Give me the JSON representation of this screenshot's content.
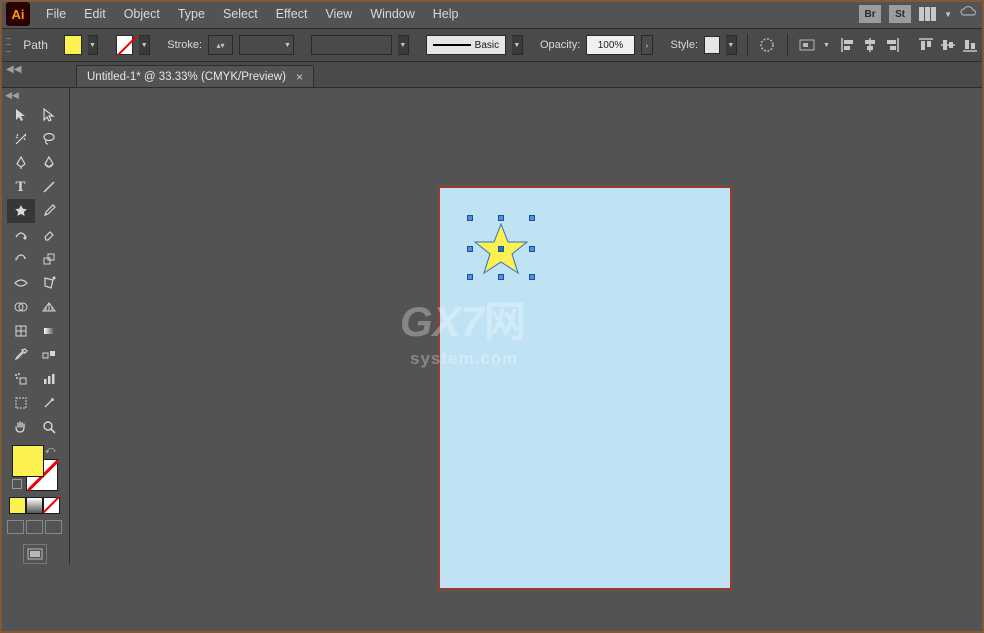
{
  "app": {
    "logo": "Ai"
  },
  "menu": {
    "file": "File",
    "edit": "Edit",
    "object": "Object",
    "type": "Type",
    "select": "Select",
    "effect": "Effect",
    "view": "View",
    "window": "Window",
    "help": "Help"
  },
  "menuRight": {
    "br": "Br",
    "st": "St"
  },
  "control": {
    "mode": "Path",
    "fill_color": "#fcf151",
    "stroke_label": "Stroke:",
    "brush_label": "Basic",
    "opacity_label": "Opacity:",
    "opacity_value": "100%",
    "style_label": "Style:"
  },
  "tab": {
    "title": "Untitled-1* @ 33.33% (CMYK/Preview)",
    "close": "×"
  },
  "tools": {
    "row_icons": [
      [
        "selection",
        "direct-selection"
      ],
      [
        "magic-wand",
        "lasso"
      ],
      [
        "pen",
        "curvature-pen"
      ],
      [
        "type",
        "line-segment"
      ],
      [
        "star",
        "paintbrush"
      ],
      [
        "shaper",
        "eraser"
      ],
      [
        "rotate",
        "scale"
      ],
      [
        "width",
        "free-transform"
      ],
      [
        "shape-builder",
        "perspective"
      ],
      [
        "mesh",
        "gradient"
      ],
      [
        "eyedropper",
        "blend"
      ],
      [
        "symbol-sprayer",
        "column-graph"
      ],
      [
        "artboard",
        "slice"
      ],
      [
        "hand",
        "zoom"
      ]
    ],
    "mini_swatches": [
      "#fcf151",
      "#ffffff",
      "#e00000"
    ]
  },
  "artboard": {
    "bg": "#bfe3f4"
  },
  "watermark": {
    "main": "GX7",
    "cn": "网",
    "sub": "system.com"
  }
}
